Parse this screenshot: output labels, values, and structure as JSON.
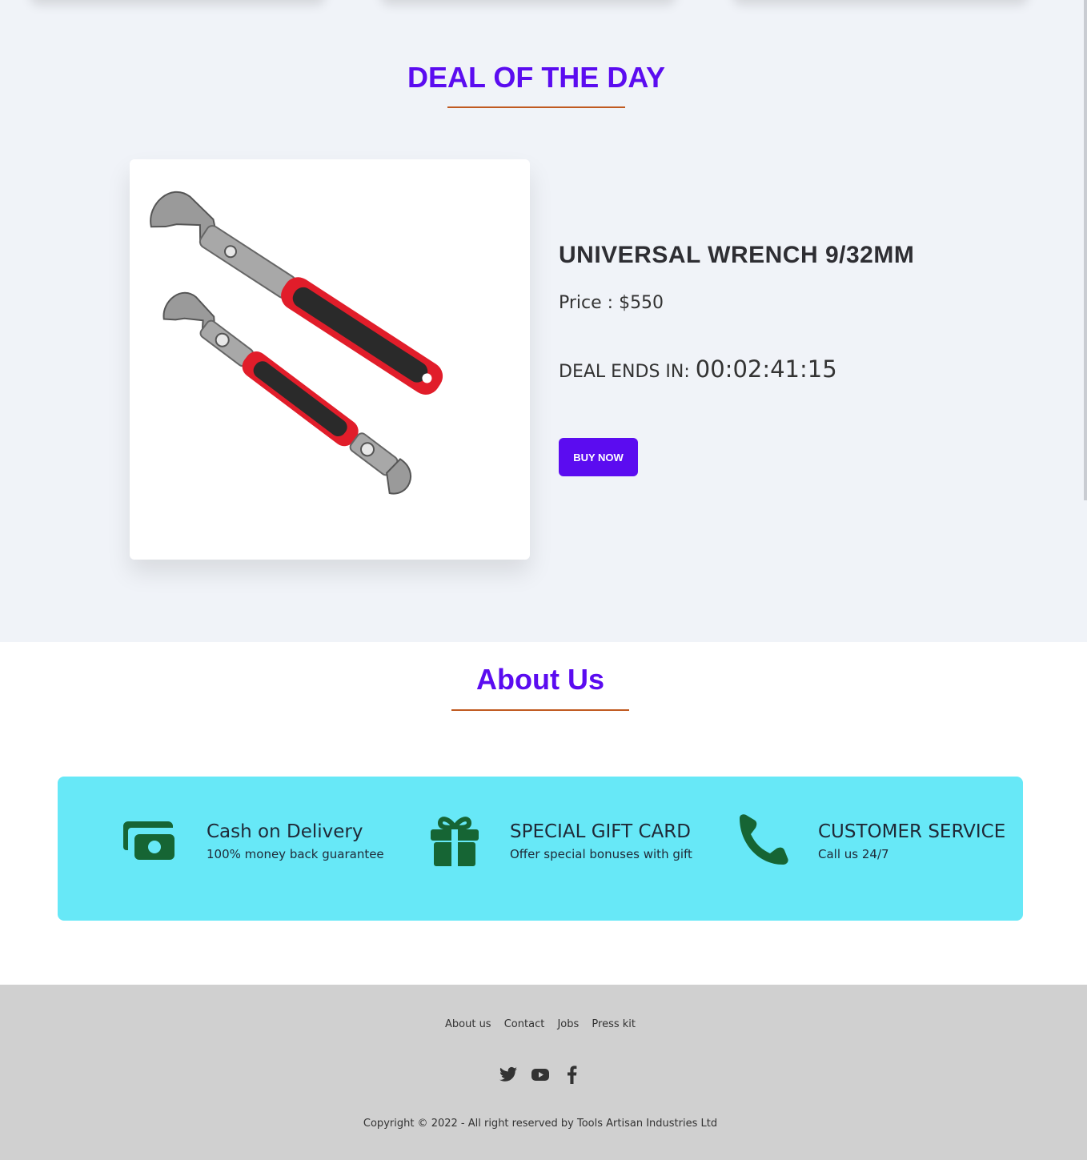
{
  "deal": {
    "section_title": "DEAL OF THE DAY",
    "product_name": "UNIVERSAL WRENCH 9/32MM",
    "price_label": "Price : $550",
    "deal_ends_label": "DEAL ENDS IN:",
    "countdown": "00:02:41:15",
    "buy_button": "BUY NOW"
  },
  "about": {
    "section_title": "About Us",
    "features": [
      {
        "icon": "money-icon",
        "title": "Cash on Delivery",
        "subtitle": "100% money back guarantee"
      },
      {
        "icon": "gift-icon",
        "title": "SPECIAL GIFT CARD",
        "subtitle": "Offer special bonuses with gift"
      },
      {
        "icon": "phone-icon",
        "title": "CUSTOMER SERVICE",
        "subtitle": "Call us 24/7"
      }
    ]
  },
  "footer": {
    "links": [
      "About us",
      "Contact",
      "Jobs",
      "Press kit"
    ],
    "socials": [
      "twitter-icon",
      "youtube-icon",
      "facebook-icon"
    ],
    "copyright": "Copyright © 2022 - All right reserved by Tools Artisan Industries Ltd"
  },
  "colors": {
    "accent": "#5b0cf0",
    "underline": "#c05a20",
    "feature_bg": "#67e8f7",
    "icon_green": "#166534",
    "footer_bg": "#d0d0d0"
  }
}
